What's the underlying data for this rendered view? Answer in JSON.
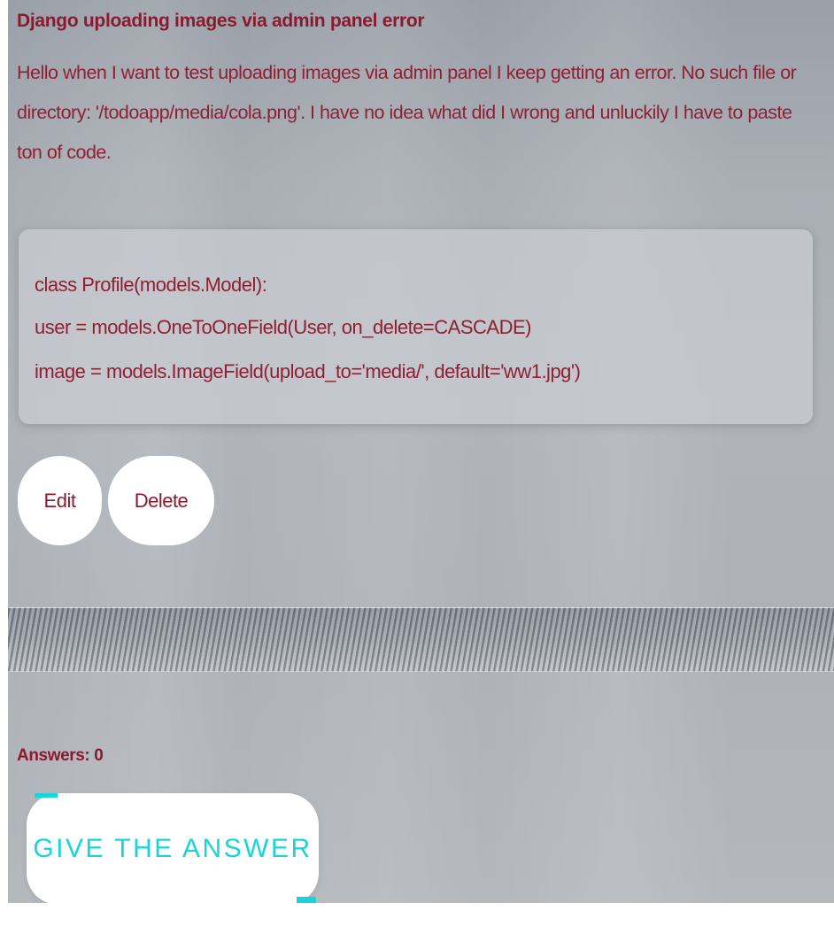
{
  "post": {
    "title": "Django uploading images via admin panel error",
    "body": "Hello when I want to test uploading images via admin panel I keep getting an error. No such file or directory: '/todoapp/media/cola.png'. I have no idea what did I wrong and unluckily I have to paste ton of code.",
    "code": {
      "line1": "class Profile(models.Model):",
      "line2": "user = models.OneToOneField(User, on_delete=CASCADE)",
      "line3": "image = models.ImageField(upload_to='media/', default='ww1.jpg')"
    },
    "actions": {
      "edit_label": "Edit",
      "delete_label": "Delete"
    }
  },
  "answers": {
    "count_label": "Answers: 0",
    "give_answer_label": "GIVE THE ANSWER"
  },
  "colors": {
    "text_primary": "#8b1a2e",
    "accent": "#16d6d9",
    "button_bg": "#ffffff"
  }
}
